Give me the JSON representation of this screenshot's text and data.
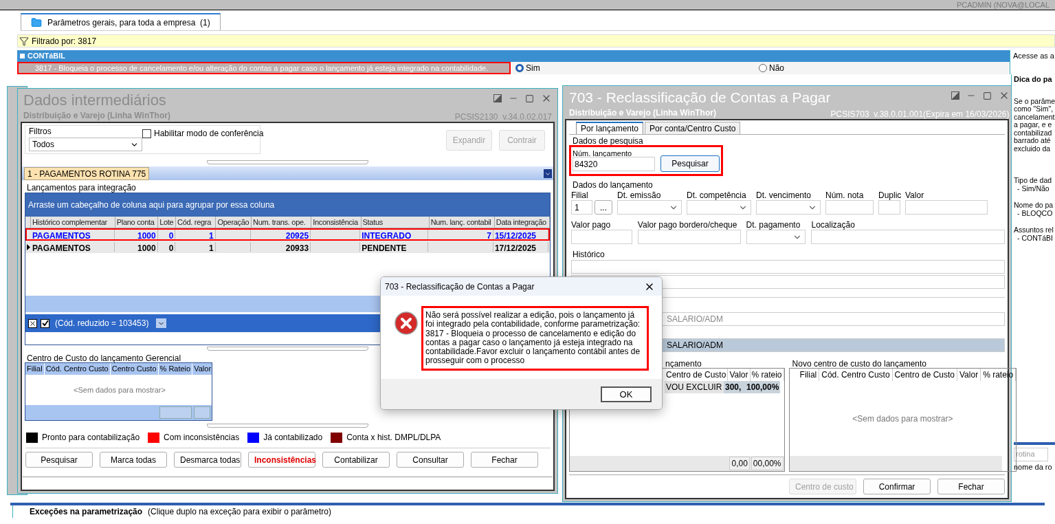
{
  "app": {
    "user": "PCADMIN (NOVA@LOCAL",
    "tabs": [
      {
        "label": "Parâmetros gerais, para toda a empresa  (1)",
        "selected": true
      }
    ],
    "filter": "Filtrado por: 3817",
    "group": {
      "title": "CONTáBIL",
      "expanded": true,
      "param": {
        "text": "3817 - Bloqueia o processo de cancelamento e/ou alteração do contas a pagar caso o lançamento já esteja integrado na contabilidade.",
        "highlighted": true,
        "options": [
          {
            "label": "Sim",
            "selected": true
          },
          {
            "label": "Não",
            "selected": false
          }
        ]
      }
    },
    "hint": {
      "header": "Acesse as a",
      "title": "Dica do pa",
      "lines": [
        "Se o parâme",
        "como \"Sim\",",
        "cancelament",
        "a pagar, e e",
        "contabilizad",
        "barrado até",
        "excluido da"
      ],
      "sections": [
        {
          "title": "Tipo de dad",
          "value": "- Sim/Não"
        },
        {
          "title": "Nome do pa",
          "value": "- BLOQCO"
        },
        {
          "title": "Assuntos rel",
          "value": "- CONTáBI"
        }
      ],
      "search_placeholder": "rotina",
      "footer": "nome da ro"
    },
    "exceptions": {
      "title": "Exceções na parametrização",
      "note": "(Clique duplo na exceção para exibir o parâmetro)"
    }
  },
  "left_window": {
    "title": "Dados intermediários",
    "subtitle": "Distribuição e Varejo (Linha WinThor)",
    "version": "PCSIS2130  v.34.0.02.017",
    "filters_label": "Filtros",
    "filter_value": "Todos",
    "checkbox": {
      "label": "Habilitar modo de conferência",
      "checked": false
    },
    "top_buttons": [
      {
        "label": "Expandir",
        "disabled": true
      },
      {
        "label": "Contrair",
        "disabled": true
      }
    ],
    "tabs": [
      {
        "label": "1 - PAGAMENTOS ROTINA 775",
        "selected": true
      }
    ],
    "group_title": "Lançamentos para integração",
    "group_panel": "Arraste um cabeçalho de coluna aqui para agrupar por essa coluna",
    "columns": [
      "Histórico complementar",
      "Plano conta",
      "Lote",
      "Cód. regra",
      "Operação",
      "Num. trans. ope.",
      "Inconsistência",
      "Status",
      "Num. lanç. contabil",
      "Data integração"
    ],
    "rows": [
      {
        "cells": [
          "PAGAMENTOS",
          "1000",
          "0",
          "1",
          "",
          "20925",
          "",
          "INTEGRADO",
          "7",
          "15/12/2025"
        ],
        "color": "#0000ff",
        "current": false,
        "highlighted": true
      },
      {
        "cells": [
          "PAGAMENTOS",
          "1000",
          "0",
          "1",
          "",
          "20933",
          "",
          "PENDENTE",
          "",
          "17/12/2025"
        ],
        "color": "#000000",
        "current": true,
        "highlighted": false
      }
    ],
    "grid_filter": {
      "enabled": true,
      "text": "(Cód. reduzido = 103453)"
    },
    "cost_title": "Centro de Custo do lançamento Gerencial",
    "cost_columns": [
      "Filial",
      "Cód. Centro Custo",
      "Centro Custo",
      "% Rateio",
      "Valor"
    ],
    "cost_empty": "<Sem dados para mostrar>",
    "legend": [
      {
        "label": "Pronto para contabilização",
        "color": "#000000"
      },
      {
        "label": "Com inconsistências",
        "color": "#ff0000"
      },
      {
        "label": "Já contabilizado",
        "color": "#0000ff"
      },
      {
        "label": "Conta x hist. DMPL/DLPA",
        "color": "#800000"
      }
    ],
    "buttons": [
      {
        "label": "Pesquisar",
        "kind": "normal"
      },
      {
        "label": "Marca todas",
        "kind": "normal"
      },
      {
        "label": "Desmarca todas",
        "kind": "normal"
      },
      {
        "label": "Inconsistências",
        "kind": "alert"
      },
      {
        "label": "Contabilizar",
        "kind": "normal"
      },
      {
        "label": "Consultar",
        "kind": "normal"
      },
      {
        "label": "Fechar",
        "kind": "normal"
      }
    ]
  },
  "right_window": {
    "title": "703 - Reclassificação de Contas a Pagar",
    "subtitle": "Distribuição e Varejo (Linha WinThor)",
    "version": "PCSIS703  v.38.0.01.001(Expira em 16/03/2026)",
    "tabs": [
      {
        "label": "Por lançamento",
        "selected": true
      },
      {
        "label": "Por conta/Centro Custo",
        "selected": false
      }
    ],
    "search": {
      "title": "Dados de pesquisa",
      "label": "Núm. lançamento",
      "value": "84320",
      "button": "Pesquisar",
      "highlighted": true
    },
    "data_title": "Dados do lançamento",
    "row1": [
      {
        "label": "Filial",
        "value": "1",
        "kind": "lookup",
        "button": "..."
      },
      {
        "label": "Dt. emissão",
        "kind": "select"
      },
      {
        "label": "Dt. competência",
        "kind": "select"
      },
      {
        "label": "Dt. vencimento",
        "kind": "select"
      },
      {
        "label": "Núm. nota",
        "kind": "text"
      },
      {
        "label": "Duplic",
        "kind": "text"
      },
      {
        "label": "Valor",
        "kind": "text"
      }
    ],
    "row2": [
      {
        "label": "Valor pago",
        "kind": "text"
      },
      {
        "label": "Valor pago bordero/cheque",
        "kind": "text"
      },
      {
        "label": "Dt. pagamento",
        "kind": "select"
      },
      {
        "label": "Localização",
        "kind": "text"
      }
    ],
    "history_label": "Histórico",
    "accounts": [
      {
        "value": "SALARIO/ADM",
        "selected": false
      },
      {
        "value": "SALARIO/ADM",
        "selected": true
      }
    ],
    "old_cost": {
      "title": "nçamento",
      "columns": [
        "Centro de Custo",
        "Valor",
        "% rateio"
      ],
      "row": [
        "VOU EXCLUIR",
        "300,",
        "100,00%"
      ],
      "totals": [
        "0,00",
        "00,00%"
      ]
    },
    "new_cost": {
      "title": "Novo centro de custo do lançamento",
      "columns": [
        "Filial",
        "Cód. Centro Custo",
        "Centro de Custo",
        "Valor",
        "% rateio"
      ],
      "empty": "<Sem dados para mostrar>"
    },
    "buttons": [
      {
        "label": "Centro de custo",
        "disabled": true
      },
      {
        "label": "Confirmar",
        "disabled": false
      },
      {
        "label": "Fechar",
        "disabled": false
      }
    ]
  },
  "dialog": {
    "title": "703 - Reclassificação de Contas a Pagar",
    "message": "Não será possível realizar a edição, pois o lançamento já foi integrado pela contabilidade, conforme parametrização:  3817 - Bloqueia o processo de cancelamento e edição do contas a pagar caso o lançamento já esteja integrado na contabilidade.Favor excluir o lançamento contábil antes de prosseguir com o processo",
    "highlighted": true,
    "button": "OK"
  }
}
